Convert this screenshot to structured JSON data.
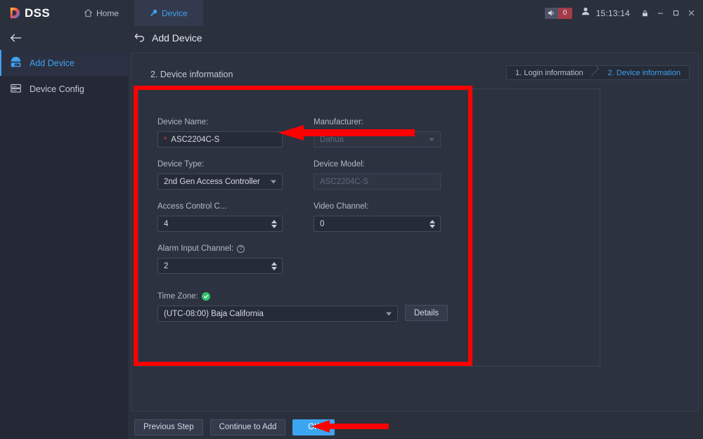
{
  "titlebar": {
    "logo_text": "DSS",
    "tabs": [
      {
        "label": "Home",
        "icon": "home-icon",
        "active": false
      },
      {
        "label": "Device",
        "icon": "wrench-icon",
        "active": true
      }
    ],
    "sound_icon": "speaker-icon",
    "alarm_count": "0",
    "user_icon": "user-icon",
    "time": "15:13:14",
    "lock_icon": "lock-icon",
    "minimize_icon": "minimize-icon",
    "maximize_icon": "maximize-icon",
    "close_icon": "close-icon"
  },
  "sidebar": {
    "back_icon": "back-arrow-icon",
    "items": [
      {
        "label": "Add Device",
        "icon": "device-dome-icon",
        "active": true
      },
      {
        "label": "Device Config",
        "icon": "server-rack-icon",
        "active": false
      }
    ]
  },
  "page": {
    "back_icon": "undo-arrow-icon",
    "title": "Add Device",
    "panel_title": "2. Device information",
    "steps": [
      {
        "label": "1. Login information",
        "active": false
      },
      {
        "label": "2. Device information",
        "active": true
      }
    ]
  },
  "form": {
    "device_name": {
      "label": "Device Name:",
      "required_mark": "*",
      "value": "ASC2204C-S"
    },
    "manufacturer": {
      "label": "Manufacturer:",
      "value": "Dahua",
      "disabled": true,
      "icon": "chevron-down-icon"
    },
    "device_type": {
      "label": "Device Type:",
      "value": "2nd Gen Access Controller",
      "icon": "chevron-down-icon"
    },
    "device_model": {
      "label": "Device Model:",
      "value": "ASC2204C-S",
      "disabled": true
    },
    "access_control_channel": {
      "label": "Access Control C...",
      "value": "4",
      "icon": "spinner-icon"
    },
    "video_channel": {
      "label": "Video Channel:",
      "value": "0",
      "icon": "spinner-icon"
    },
    "alarm_input_channel": {
      "label": "Alarm Input Channel:",
      "value": "2",
      "help_icon": "help-circle-icon",
      "help_glyph": "?"
    },
    "time_zone": {
      "label": "Time Zone:",
      "value": "(UTC-08:00) Baja California",
      "status_icon": "green-check-icon",
      "check_glyph": "✓",
      "details_button": "Details"
    }
  },
  "footer": {
    "previous_step": "Previous Step",
    "continue_to_add": "Continue to Add",
    "ok": "OK"
  },
  "annotations": {
    "highlight_color": "#fe0000",
    "box_label": "form-highlight-box",
    "arrow_device_name": "arrow-pointing-to-device-name",
    "arrow_ok": "arrow-pointing-to-ok-button"
  }
}
